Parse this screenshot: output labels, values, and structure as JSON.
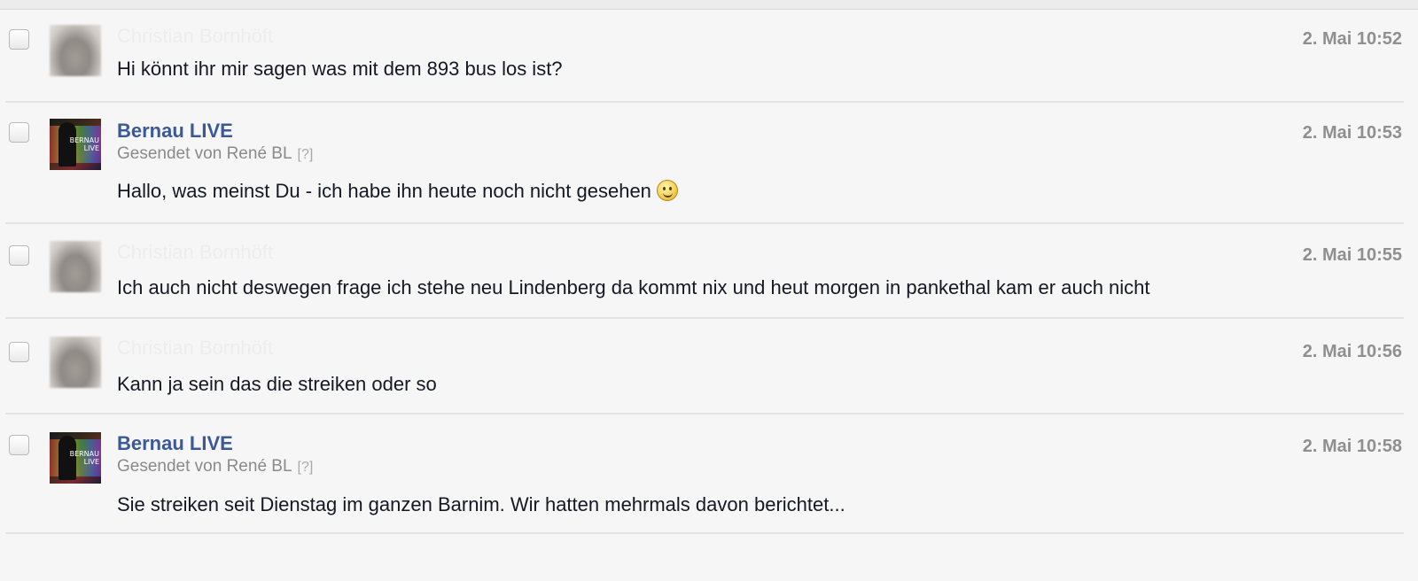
{
  "messages": [
    {
      "sender": "Christian Bornhöft",
      "sender_hidden": true,
      "avatar": "blurred-person-photo",
      "time": "2. Mai 10:52",
      "text": "Hi könnt ihr mir sagen was mit dem 893 bus los ist?"
    },
    {
      "sender": "Bernau LIVE",
      "sent_by": "Gesendet von René BL",
      "help": "[?]",
      "avatar": "bernau-live-logo",
      "avatar_text": "BERNAU LIVE",
      "time": "2. Mai 10:53",
      "text": "Hallo, was meinst Du - ich habe ihn heute noch nicht gesehen",
      "emoji": "smiley-emoji-icon"
    },
    {
      "sender": "Christian Bornhöft",
      "sender_hidden": true,
      "avatar": "blurred-person-photo",
      "time": "2. Mai 10:55",
      "text": "Ich auch nicht deswegen frage ich stehe neu Lindenberg da kommt nix und heut morgen in pankethal kam er auch nicht"
    },
    {
      "sender": "Christian Bornhöft",
      "sender_hidden": true,
      "avatar": "blurred-person-photo",
      "time": "2. Mai 10:56",
      "text": "Kann ja sein das die streiken oder so"
    },
    {
      "sender": "Bernau LIVE",
      "sent_by": "Gesendet von René BL",
      "help": "[?]",
      "avatar": "bernau-live-logo",
      "avatar_text": "BERNAU LIVE",
      "time": "2. Mai 10:58",
      "text": "Sie streiken seit Dienstag im ganzen Barnim. Wir hatten mehrmals davon berichtet..."
    }
  ],
  "colors": {
    "sender_link": "#3b5998",
    "timestamp": "#8f8f8f",
    "background": "#f6f6f6"
  }
}
